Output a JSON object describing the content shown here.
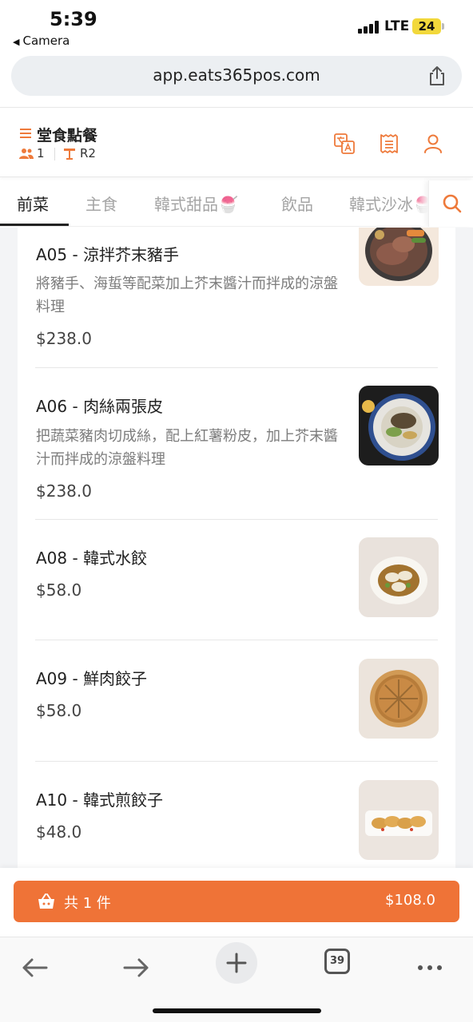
{
  "status_bar": {
    "time": "5:39",
    "back_label": "Camera",
    "network": "LTE",
    "battery": "24"
  },
  "browser": {
    "url": "app.eats365pos.com",
    "tab_count": "39"
  },
  "header": {
    "title": "堂食點餐",
    "guest_count": "1",
    "table": "R2"
  },
  "tabs": [
    {
      "label": "前菜",
      "active": true
    },
    {
      "label": "主食",
      "active": false
    },
    {
      "label": "韓式甜品🍧",
      "active": false
    },
    {
      "label": "飲品",
      "active": false
    },
    {
      "label": "韓式沙冰🍧",
      "active": false
    }
  ],
  "items": [
    {
      "name": "A05 - 涼拌芥末豬手",
      "desc": "將豬手、海蜇等配菜加上芥末醬汁而拌成的涼盤料理",
      "price": "$238.0",
      "image": "pork-knuckle-plate"
    },
    {
      "name": "A06 - 肉絲兩張皮",
      "desc": "把蔬菜豬肉切成絲，配上紅薯粉皮，加上芥末醬汁而拌成的涼盤料理",
      "price": "$238.0",
      "image": "noodle-salad-plate"
    },
    {
      "name": "A08 - 韓式水餃",
      "desc": "",
      "price": "$58.0",
      "image": "boiled-dumplings"
    },
    {
      "name": "A09 - 鮮肉餃子",
      "desc": "",
      "price": "$58.0",
      "image": "steamer-dumplings"
    },
    {
      "name": "A10 - 韓式煎餃子",
      "desc": "",
      "price": "$48.0",
      "image": "fried-dumplings"
    }
  ],
  "cart": {
    "count_label": "共 1 件",
    "total": "$108.0"
  },
  "colors": {
    "accent": "#ef7337",
    "icon_orange": "#ee7a3b"
  }
}
